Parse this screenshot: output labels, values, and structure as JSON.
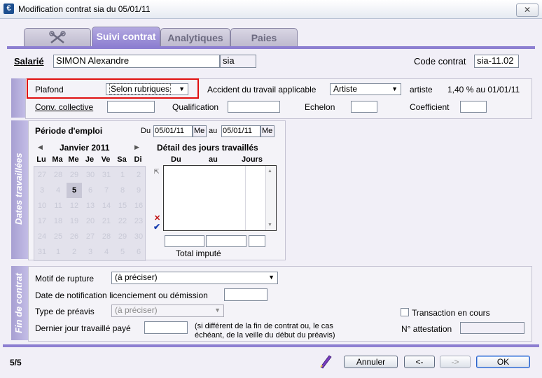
{
  "window": {
    "title": "Modification contrat sia du 05/01/11",
    "app_icon": "€",
    "close_glyph": "✕"
  },
  "tabs": [
    {
      "label": ""
    },
    {
      "label": "Suivi contrat"
    },
    {
      "label": "Analytiques"
    },
    {
      "label": "Paies"
    }
  ],
  "header": {
    "salarie_label": "Salarié",
    "salarie_name": "SIMON Alexandre",
    "salarie_code": "sia",
    "code_contrat_label": "Code contrat",
    "code_contrat_value": "sia-11.02"
  },
  "contract": {
    "plafond_label": "Plafond",
    "plafond_value": "Selon rubriques",
    "accident_label": "Accident du travail applicable",
    "accident_value": "Artiste",
    "accident_type": "artiste",
    "accident_rate": "1,40 % au 01/01/11",
    "conv_label": "Conv. collective",
    "qualification_label": "Qualification",
    "echelon_label": "Echelon",
    "coefficient_label": "Coefficient"
  },
  "dates": {
    "side_label": "Dates travaillées",
    "period_label": "Période d'emploi",
    "du_label": "Du",
    "du_value": "05/01/11",
    "du_suffix": "Me",
    "au_label": "au",
    "au_value": "05/01/11",
    "au_suffix": "Me",
    "calendar": {
      "month": "Janvier 2011",
      "prev": "◀",
      "next": "▶",
      "weekdays": [
        "Lu",
        "Ma",
        "Me",
        "Je",
        "Ve",
        "Sa",
        "Di"
      ],
      "weeks": [
        [
          "27",
          "28",
          "29",
          "30",
          "31",
          "1",
          "2"
        ],
        [
          "3",
          "4",
          "5",
          "6",
          "7",
          "8",
          "9"
        ],
        [
          "10",
          "11",
          "12",
          "13",
          "14",
          "15",
          "16"
        ],
        [
          "17",
          "18",
          "19",
          "20",
          "21",
          "22",
          "23"
        ],
        [
          "24",
          "25",
          "26",
          "27",
          "28",
          "29",
          "30"
        ],
        [
          "31",
          "1",
          "2",
          "3",
          "4",
          "5",
          "6"
        ]
      ],
      "selected": "5"
    },
    "detail_title": "Détail des jours travaillés",
    "detail_columns": [
      "Du",
      "au",
      "Jours"
    ],
    "total_label": "Total imputé"
  },
  "fin": {
    "side_label": "Fin de contrat",
    "motif_label": "Motif de rupture",
    "motif_value": "(à préciser)",
    "notification_label": "Date de notification licenciement ou démission",
    "preavis_label": "Type de préavis",
    "preavis_value": "(à préciser)",
    "dernier_label": "Dernier jour travaillé payé",
    "dernier_note_1": "(si différent de la fin de contrat ou, le cas",
    "dernier_note_2": "échéant, de la veille du début du préavis)",
    "transaction_label": "Transaction en cours",
    "attestation_label": "N° attestation"
  },
  "footer": {
    "page": "5/5",
    "annuler": "Annuler",
    "prev": "<-",
    "next": "->",
    "ok": "OK"
  },
  "colors": {
    "accent": "#8d7fd1",
    "highlight_border": "#e01010"
  }
}
